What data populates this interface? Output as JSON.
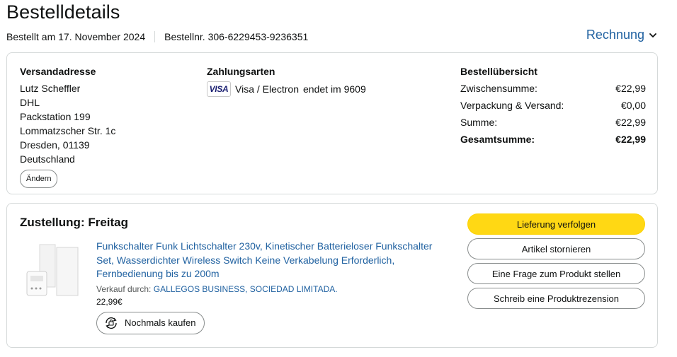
{
  "header": {
    "title": "Bestelldetails",
    "ordered": "Bestellt am 17. November 2024",
    "order_number": "Bestellnr. 306-6229453-9236351",
    "invoice_label": "Rechnung"
  },
  "shipping": {
    "heading": "Versandadresse",
    "lines": [
      "Lutz Scheffler",
      "DHL",
      "Packstation 199",
      "Lommatzscher Str. 1c",
      "Dresden, 01139",
      "Deutschland"
    ],
    "change_label": "Ändern"
  },
  "payment": {
    "heading": "Zahlungsarten",
    "card_logo": "VISA",
    "card_text": "Visa / Electron",
    "card_ending": "endet im 9609"
  },
  "summary": {
    "heading": "Bestellübersicht",
    "rows": [
      {
        "label": "Zwischensumme:",
        "value": "€22,99"
      },
      {
        "label": "Verpackung & Versand:",
        "value": "€0,00"
      },
      {
        "label": "Summe:",
        "value": "€22,99"
      },
      {
        "label": "Gesamtsumme:",
        "value": "€22,99"
      }
    ]
  },
  "delivery": {
    "title": "Zustellung: Freitag",
    "product_title": "Funkschalter Funk Lichtschalter 230v, Kinetischer Batterieloser Funkschalter Set, Wasserdichter Wireless Switch Keine Verkabelung Erforderlich, Fernbedienung bis zu 200m",
    "seller_prefix": "Verkauf durch:",
    "seller_name": "GALLEGOS BUSINESS, SOCIEDAD LIMITADA.",
    "price": "22,99€",
    "rebuy_label": "Nochmals kaufen"
  },
  "actions": {
    "track": "Lieferung verfolgen",
    "cancel": "Artikel stornieren",
    "question": "Eine Frage zum Produkt stellen",
    "review": "Schreib eine Produktrezension"
  },
  "colors": {
    "link": "#2162a1",
    "primary_button": "#ffd814",
    "border": "#d5d9d9"
  },
  "icons": [
    "chevron-down-icon",
    "visa-card-icon",
    "rebuy-icon"
  ]
}
